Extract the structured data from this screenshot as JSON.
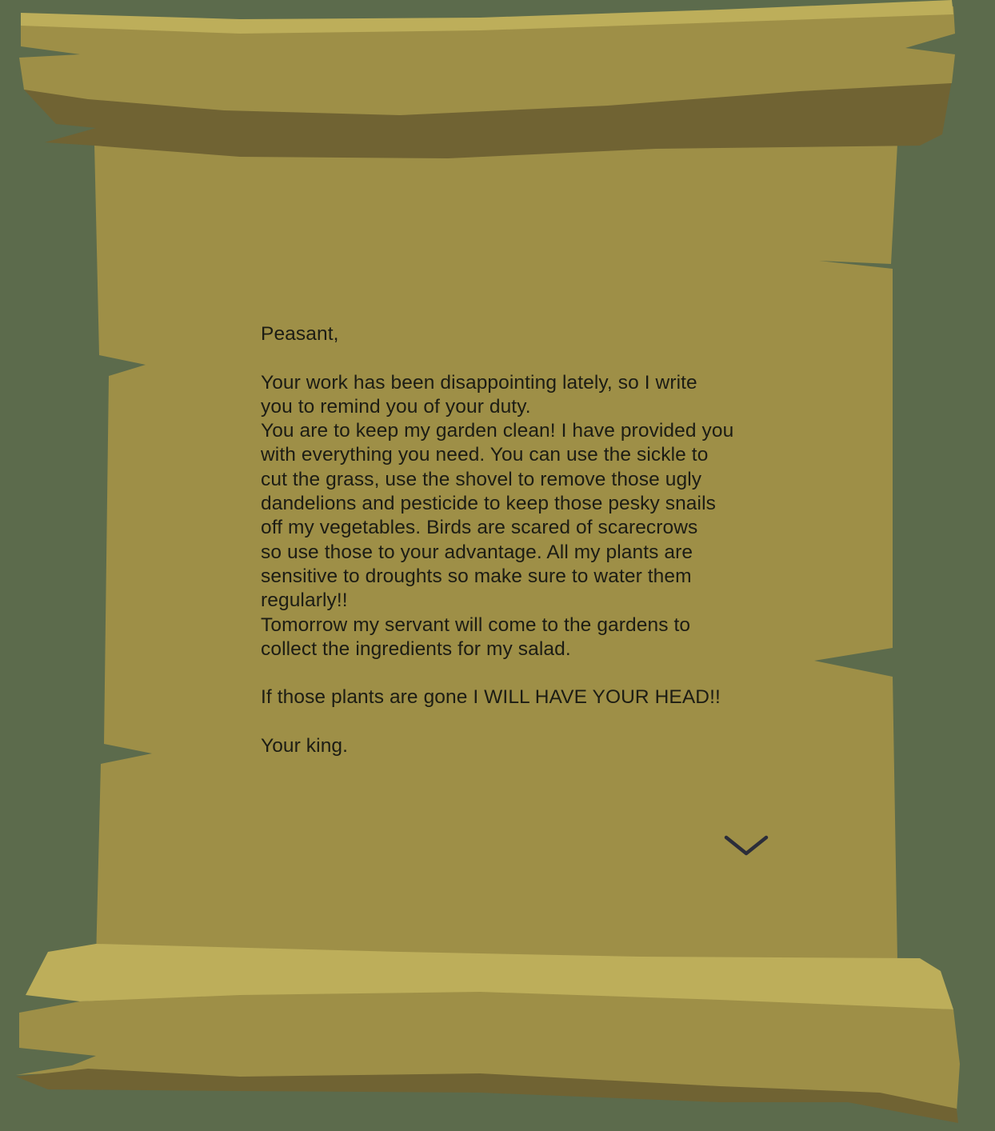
{
  "letter": {
    "greeting": "Peasant,",
    "paragraph1": "Your work has been disappointing lately, so I write\nyou to remind you of your duty.\nYou are to keep my garden clean! I have provided you\nwith everything you need. You can use the sickle to\ncut the grass, use the shovel to remove those ugly\ndandelions and pesticide to keep those pesky snails\noff my vegetables. Birds are scared of scarecrows\nso use those to your advantage. All my plants are\nsensitive to droughts so make sure to water them\nregularly!!\nTomorrow my servant will come to the gardens to\ncollect the ingredients for my salad.",
    "threat": "If those plants are gone I WILL HAVE YOUR HEAD!!",
    "signature": "Your king."
  },
  "continue_button": {
    "icon": "chevron-down-icon"
  },
  "colors": {
    "background": "#5c6b4c",
    "parchment": "#9e8f47",
    "parchment_light": "#bdae5a",
    "parchment_shadow": "#706333",
    "text": "#1c1c14",
    "chevron": "#2b2d3a"
  }
}
